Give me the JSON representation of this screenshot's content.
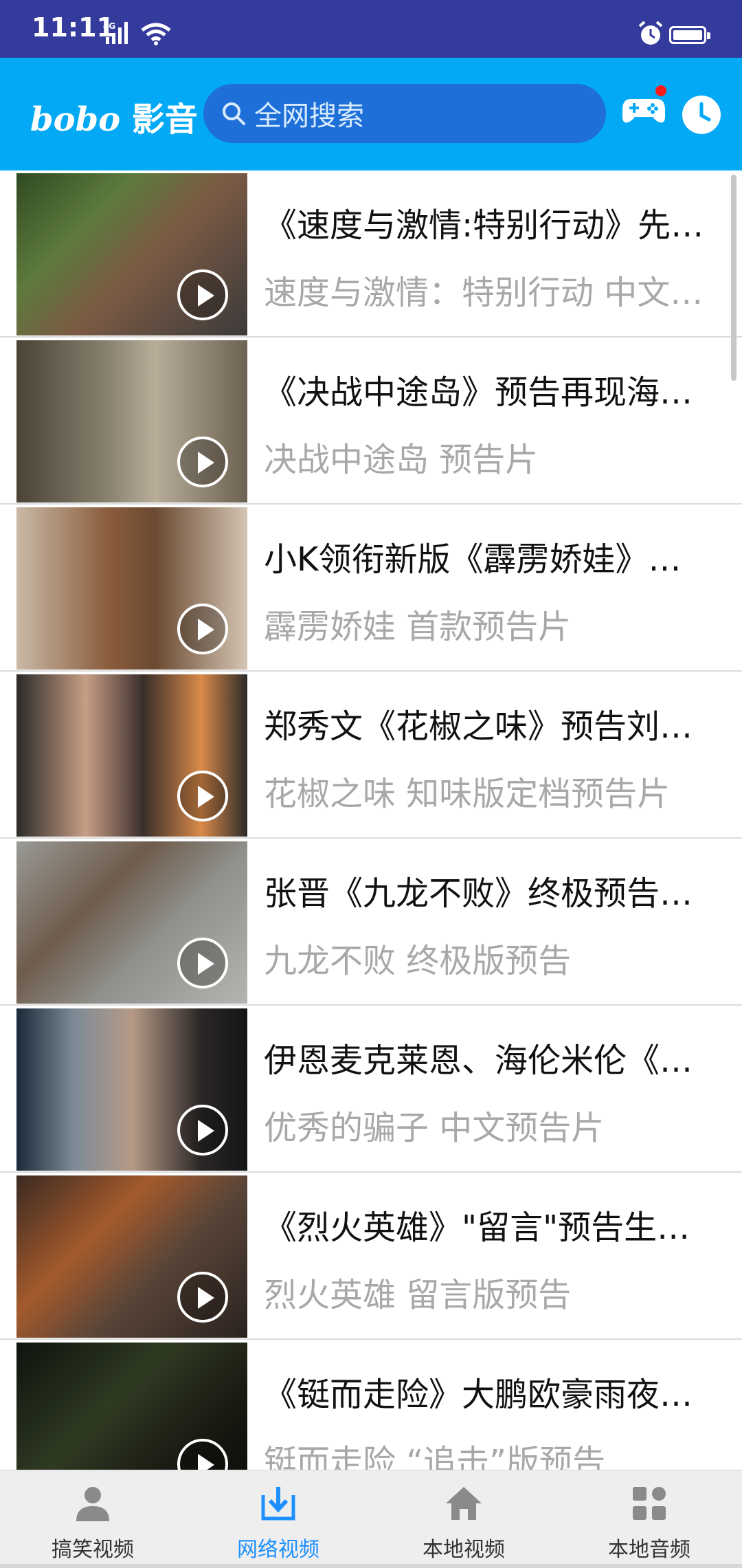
{
  "status_bar": {
    "time": "11:11",
    "network": "4G"
  },
  "app_bar": {
    "brand_latin": "bobo",
    "brand_cn": "影音",
    "search_placeholder": "全网搜索"
  },
  "videos": [
    {
      "title": "《速度与激情:特别行动》先导预告",
      "subtitle": "速度与激情：特别行动 中文预告"
    },
    {
      "title": "《决战中途岛》预告再现海空激战",
      "subtitle": "决战中途岛 预告片"
    },
    {
      "title": "小K领衔新版《霹雳娇娃》首曝预告",
      "subtitle": "霹雳娇娃 首款预告片"
    },
    {
      "title": "郑秀文《花椒之味》预告刘德华客串",
      "subtitle": "花椒之味  知味版定档预告片"
    },
    {
      "title": "张晋《九龙不败》终极预告燃爆",
      "subtitle": "九龙不败 终极版预告"
    },
    {
      "title": "伊恩麦克莱恩、海伦米伦《优秀的骗子》",
      "subtitle": "优秀的骗子 中文预告片"
    },
    {
      "title": "《烈火英雄》\"留言\"预告生死之间",
      "subtitle": "烈火英雄 留言版预告"
    },
    {
      "title": "《铤而走险》大鹏欧豪雨夜追击",
      "subtitle": "铤而走险 “追击”版预告"
    }
  ],
  "bottom_nav": [
    {
      "label": "搞笑视频",
      "icon": "person-icon",
      "active": false
    },
    {
      "label": "网络视频",
      "icon": "download-icon",
      "active": true
    },
    {
      "label": "本地视频",
      "icon": "home-icon",
      "active": false
    },
    {
      "label": "本地音频",
      "icon": "apps-grid-icon",
      "active": false
    }
  ],
  "colors": {
    "status_bar": "#343b9c",
    "app_bar": "#03a9f4",
    "search_bg": "#1e6fd8",
    "active_tab": "#1e90ff"
  }
}
